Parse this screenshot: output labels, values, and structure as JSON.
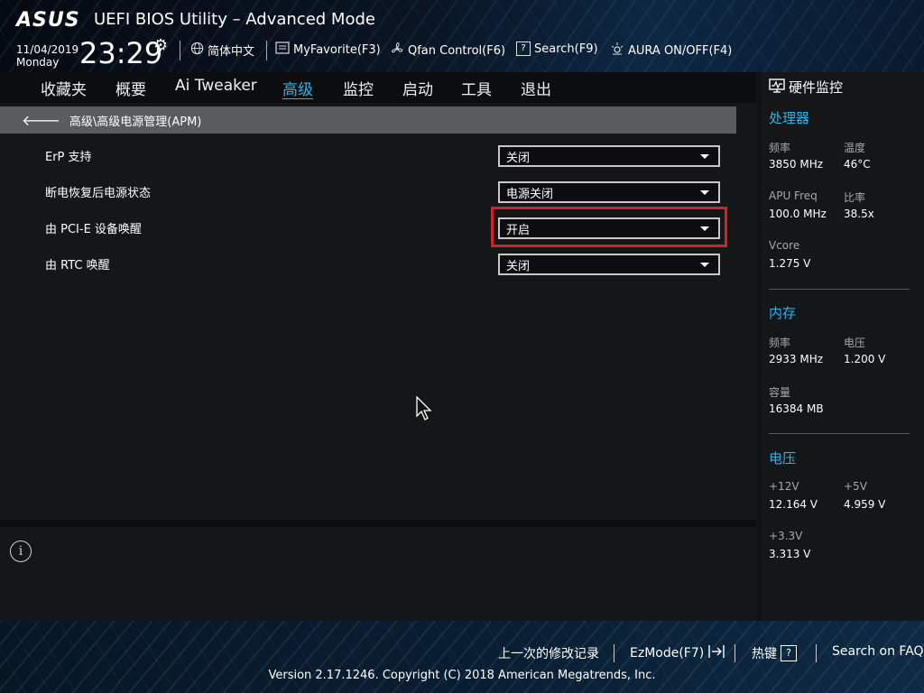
{
  "header": {
    "logo": "ASUS",
    "title": "UEFI BIOS Utility – Advanced Mode",
    "date": "11/04/2019",
    "weekday": "Monday",
    "time": "23:29",
    "buttons": [
      {
        "icon": "globe-icon",
        "label": "简体中文"
      },
      {
        "icon": "favorite-list-icon",
        "label": "MyFavorite(F3)"
      },
      {
        "icon": "fan-icon",
        "label": "Qfan Control(F6)"
      },
      {
        "icon": "question-box-icon",
        "label": "Search(F9)"
      },
      {
        "icon": "light-icon",
        "label": "AURA ON/OFF(F4)"
      }
    ]
  },
  "tabs": [
    "收藏夹",
    "概要",
    "Ai Tweaker",
    "高级",
    "监控",
    "启动",
    "工具",
    "退出"
  ],
  "active_tab": "高级",
  "breadcrumb": "高级\\高级电源管理(APM)",
  "settings": [
    {
      "label": "ErP 支持",
      "value": "关闭"
    },
    {
      "label": "断电恢复后电源状态",
      "value": "电源关闭"
    },
    {
      "label": "由 PCI-E 设备唤醒",
      "value": "开启",
      "highlighted": true
    },
    {
      "label": "由 RTC 唤醒",
      "value": "关闭"
    }
  ],
  "info_icon_glyph": "i",
  "monitor": {
    "title": "硬件监控",
    "cpu": {
      "title": "处理器",
      "freq_label": "频率",
      "freq": "3850 MHz",
      "temp_label": "温度",
      "temp": "46°C",
      "apu_label": "APU Freq",
      "apu": "100.0 MHz",
      "ratio_label": "比率",
      "ratio": "38.5x",
      "vcore_label": "Vcore",
      "vcore": "1.275 V"
    },
    "memory": {
      "title": "内存",
      "freq_label": "频率",
      "freq": "2933 MHz",
      "volt_label": "电压",
      "volt": "1.200 V",
      "cap_label": "容量",
      "cap": "16384 MB"
    },
    "voltage": {
      "title": "电压",
      "v12_label": "+12V",
      "v12": "12.164 V",
      "v5_label": "+5V",
      "v5": "4.959 V",
      "v33_label": "+3.3V",
      "v33": "3.313 V"
    }
  },
  "footer": {
    "last_changes": "上一次的修改记录",
    "ezmode": "EzMode(F7)",
    "hotkeys": "热键",
    "hotkeys_key": "?",
    "faq": "Search on FAQ",
    "copyright": "Version 2.17.1246. Copyright (C) 2018 American Megatrends, Inc."
  },
  "colors": {
    "accent": "#2ab3e8",
    "highlight_border": "#d4222a",
    "breadcrumb_bg": "#5a5b5e",
    "panel_bg": "#151618"
  }
}
